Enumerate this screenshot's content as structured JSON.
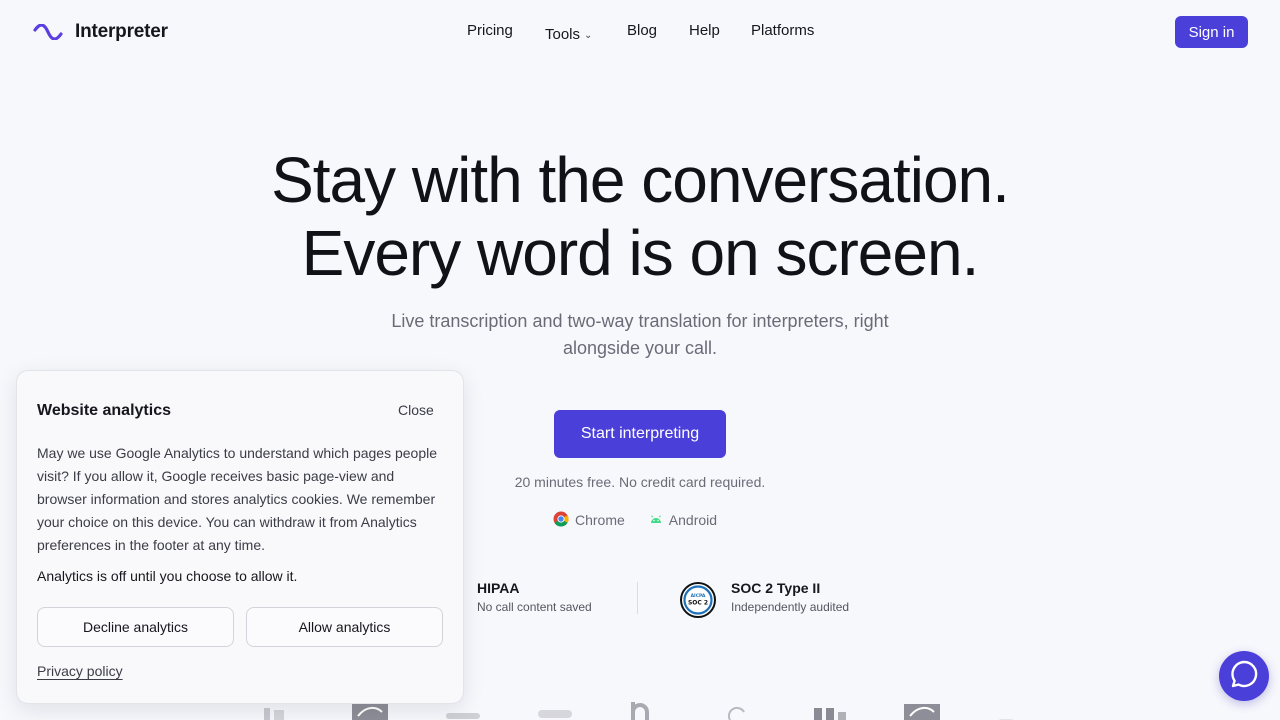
{
  "brand": {
    "name": "Interpreter",
    "accent": "#4b3fd9",
    "logo_color": "#5b3fe0"
  },
  "nav": {
    "items": [
      {
        "label": "Pricing"
      },
      {
        "label": "Tools",
        "dropdown": true
      },
      {
        "label": "Blog"
      },
      {
        "label": "Help"
      },
      {
        "label": "Platforms"
      }
    ],
    "signin_label": "Sign in"
  },
  "hero": {
    "title_line1": "Stay with the conversation.",
    "title_line2": "Every word is on screen.",
    "subtitle": "Live transcription and two-way translation for interpreters, right alongside your call.",
    "cta_label": "Start interpreting",
    "cta_note": "20 minutes free. No credit card required.",
    "platforms": [
      {
        "label": "Chrome",
        "icon": "chrome-icon"
      },
      {
        "label": "Android",
        "icon": "android-icon"
      }
    ]
  },
  "trust": [
    {
      "title": "HIPAA",
      "subtitle": "No call content saved"
    },
    {
      "title": "SOC 2 Type II",
      "subtitle": "Independently audited",
      "badge_top": "AICPA",
      "badge_bottom": "SOC 2"
    }
  ],
  "cookie": {
    "title": "Website analytics",
    "close_label": "Close",
    "body": "May we use Google Analytics to understand which pages people visit? If you allow it, Google receives basic page-view and browser information and stores analytics cookies. We remember your choice on this device. You can withdraw it from Analytics preferences in the footer at any time.",
    "status": "Analytics is off until you choose to allow it.",
    "decline_label": "Decline analytics",
    "allow_label": "Allow analytics",
    "privacy_label": "Privacy policy"
  },
  "chat": {
    "icon": "chat-bubble-icon"
  }
}
